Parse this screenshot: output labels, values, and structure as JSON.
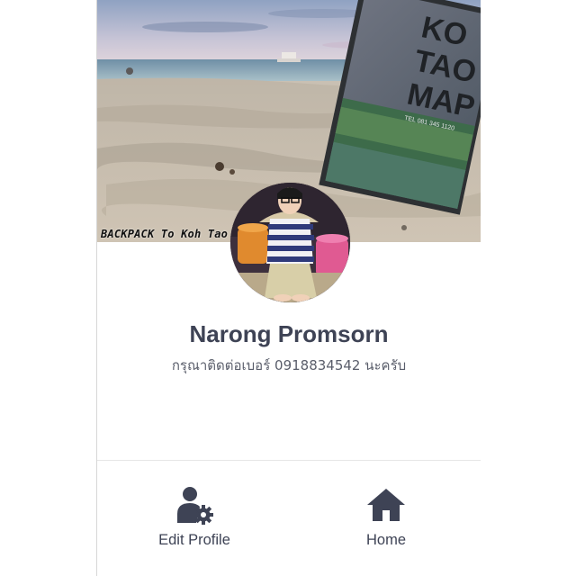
{
  "cover": {
    "caption": "BACKPACK To Koh Tao",
    "book_title_lines": [
      "KO",
      "TAO",
      "MAP"
    ],
    "book_subtitle": "TEL 081 345 1120"
  },
  "profile": {
    "name": "Narong Promsorn",
    "status_message": "กรุณาติดต่อเบอร์ 0918834542 นะครับ"
  },
  "actions": [
    {
      "label": "Edit Profile",
      "icon": "edit-profile-icon"
    },
    {
      "label": "Home",
      "icon": "home-icon"
    }
  ],
  "colors": {
    "text_primary": "#3e4355",
    "text_secondary": "#5a5e6b",
    "icon": "#3e4355",
    "divider": "#e6e6e6"
  }
}
